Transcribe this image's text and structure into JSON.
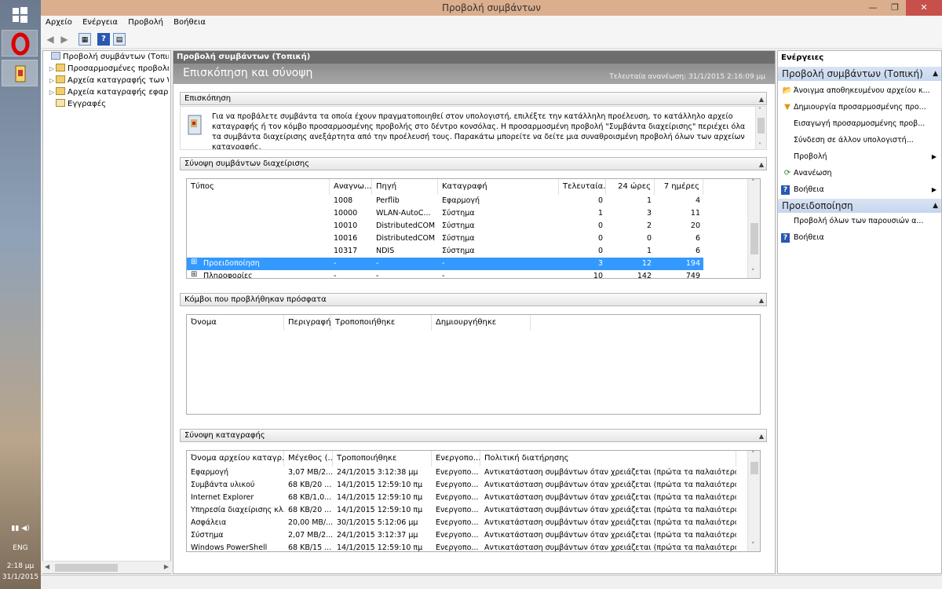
{
  "taskbar": {
    "time": "2:18 μμ",
    "date": "31/1/2015",
    "lang": "ENG"
  },
  "window": {
    "title": "Προβολή συμβάντων"
  },
  "menu": [
    "Αρχείο",
    "Ενέργεια",
    "Προβολή",
    "Βοήθεια"
  ],
  "tree": {
    "items": [
      {
        "label": "Προβολή συμβάντων (Τοπική)",
        "level": 0,
        "expand": ""
      },
      {
        "label": "Προσαρμοσμένες προβολές",
        "level": 1,
        "expand": "▷"
      },
      {
        "label": "Αρχεία καταγραφής των Wi",
        "level": 1,
        "expand": "▷"
      },
      {
        "label": "Αρχεία καταγραφής εφαρμ",
        "level": 1,
        "expand": "▷"
      },
      {
        "label": "Εγγραφές",
        "level": 1,
        "expand": ""
      }
    ]
  },
  "center": {
    "header": "Προβολή συμβάντων (Τοπική)",
    "banner_title": "Επισκόπηση και σύνοψη",
    "banner_updated": "Τελευταία ανανέωση: 31/1/2015 2:16:09 μμ",
    "overview": {
      "title": "Επισκόπηση",
      "text": "Για να προβάλετε συμβάντα τα οποία έχουν πραγματοποιηθεί στον υπολογιστή, επιλέξτε την κατάλληλη προέλευση, το κατάλληλο αρχείο καταγραφής ή τον κόμβο προσαρμοσμένης προβολής στο δέντρο κονσόλας. Η προσαρμοσμένη προβολή \"Συμβάντα διαχείρισης\" περιέχει όλα τα συμβάντα διαχείρισης ανεξάρτητα από την προέλευσή τους. Παρακάτω μπορείτε να δείτε μια συναθροισμένη προβολή όλων των αρχείων καταγραφής."
    },
    "admin_summary": {
      "title": "Σύνοψη συμβάντων διαχείρισης",
      "columns": [
        "Τύπος",
        "Αναγνω...",
        "Πηγή",
        "Καταγραφή",
        "Τελευταία...",
        "24 ώρες",
        "7 ημέρες"
      ],
      "rows": [
        {
          "type": "",
          "id": "1008",
          "source": "Perflib",
          "log": "Εφαρμογή",
          "last": "0",
          "d1": "1",
          "d7": "4"
        },
        {
          "type": "",
          "id": "10000",
          "source": "WLAN-AutoC...",
          "log": "Σύστημα",
          "last": "1",
          "d1": "3",
          "d7": "11"
        },
        {
          "type": "",
          "id": "10010",
          "source": "DistributedCOM",
          "log": "Σύστημα",
          "last": "0",
          "d1": "2",
          "d7": "20"
        },
        {
          "type": "",
          "id": "10016",
          "source": "DistributedCOM",
          "log": "Σύστημα",
          "last": "0",
          "d1": "0",
          "d7": "6"
        },
        {
          "type": "",
          "id": "10317",
          "source": "NDIS",
          "log": "Σύστημα",
          "last": "0",
          "d1": "1",
          "d7": "6"
        },
        {
          "type": "Προειδοποίηση",
          "id": "-",
          "source": "-",
          "log": "-",
          "last": "3",
          "d1": "12",
          "d7": "194",
          "selected": true,
          "group": true
        },
        {
          "type": "Πληροφορίες",
          "id": "-",
          "source": "-",
          "log": "-",
          "last": "10",
          "d1": "142",
          "d7": "749",
          "group": true
        }
      ]
    },
    "recent_nodes": {
      "title": "Κόμβοι που προβλήθηκαν πρόσφατα",
      "columns": [
        "Όνομα",
        "Περιγραφή",
        "Τροποποιήθηκε",
        "Δημιουργήθηκε"
      ]
    },
    "log_summary": {
      "title": "Σύνοψη καταγραφής",
      "columns": [
        "Όνομα αρχείου καταγρ...",
        "Μέγεθος (...",
        "Τροποποιήθηκε",
        "Ενεργοπο...",
        "Πολιτική διατήρησης"
      ],
      "rows": [
        {
          "name": "Εφαρμογή",
          "size": "3,07 MB/2...",
          "mod": "24/1/2015 3:12:38 μμ",
          "enabled": "Ενεργοπο...",
          "policy": "Αντικατάσταση συμβάντων όταν χρειάζεται (πρώτα τα παλαιότερα ..."
        },
        {
          "name": "Συμβάντα υλικού",
          "size": "68 KB/20 ...",
          "mod": "14/1/2015 12:59:10 πμ",
          "enabled": "Ενεργοπο...",
          "policy": "Αντικατάσταση συμβάντων όταν χρειάζεται (πρώτα τα παλαιότερα ..."
        },
        {
          "name": "Internet Explorer",
          "size": "68 KB/1,0...",
          "mod": "14/1/2015 12:59:10 πμ",
          "enabled": "Ενεργοπο...",
          "policy": "Αντικατάσταση συμβάντων όταν χρειάζεται (πρώτα τα παλαιότερα ..."
        },
        {
          "name": "Υπηρεσία διαχείρισης κλ...",
          "size": "68 KB/20 ...",
          "mod": "14/1/2015 12:59:10 πμ",
          "enabled": "Ενεργοπο...",
          "policy": "Αντικατάσταση συμβάντων όταν χρειάζεται (πρώτα τα παλαιότερα ..."
        },
        {
          "name": "Ασφάλεια",
          "size": "20,00 MB/...",
          "mod": "30/1/2015 5:12:06 μμ",
          "enabled": "Ενεργοπο...",
          "policy": "Αντικατάσταση συμβάντων όταν χρειάζεται (πρώτα τα παλαιότερα ..."
        },
        {
          "name": "Σύστημα",
          "size": "2,07 MB/2...",
          "mod": "24/1/2015 3:12:37 μμ",
          "enabled": "Ενεργοπο...",
          "policy": "Αντικατάσταση συμβάντων όταν χρειάζεται (πρώτα τα παλαιότερα ..."
        },
        {
          "name": "Windows PowerShell",
          "size": "68 KB/15 ...",
          "mod": "14/1/2015 12:59:10 πμ",
          "enabled": "Ενεργοπο...",
          "policy": "Αντικατάσταση συμβάντων όταν χρειάζεται (πρώτα τα παλαιότερα ..."
        }
      ]
    }
  },
  "actions": {
    "title": "Ενέργειες",
    "section1": {
      "title": "Προβολή συμβάντων (Τοπική)",
      "items": [
        {
          "label": "Άνοιγμα αποθηκευμένου αρχείου κ...",
          "icon": "folder-open-icon",
          "glyph": "📂"
        },
        {
          "label": "Δημιουργία προσαρμοσμένης προ...",
          "icon": "filter-icon",
          "glyph": "▼"
        },
        {
          "label": "Εισαγωγή προσαρμοσμένης προβ...",
          "icon": "",
          "glyph": ""
        },
        {
          "label": "Σύνδεση σε άλλον υπολογιστή...",
          "icon": "",
          "glyph": ""
        },
        {
          "label": "Προβολή",
          "icon": "",
          "glyph": "",
          "submenu": true
        },
        {
          "label": "Ανανέωση",
          "icon": "refresh-icon",
          "glyph": "⟳"
        },
        {
          "label": "Βοήθεια",
          "icon": "help-icon",
          "glyph": "?",
          "submenu": true
        }
      ]
    },
    "section2": {
      "title": "Προειδοποίηση",
      "items": [
        {
          "label": "Προβολή όλων των παρουσιών α...",
          "icon": "",
          "glyph": ""
        },
        {
          "label": "Βοήθεια",
          "icon": "help-icon",
          "glyph": "?"
        }
      ]
    }
  },
  "colors": {
    "titlebar": "#dbae8e",
    "selection": "#3399ff",
    "action_header": "#c5d6ee"
  }
}
